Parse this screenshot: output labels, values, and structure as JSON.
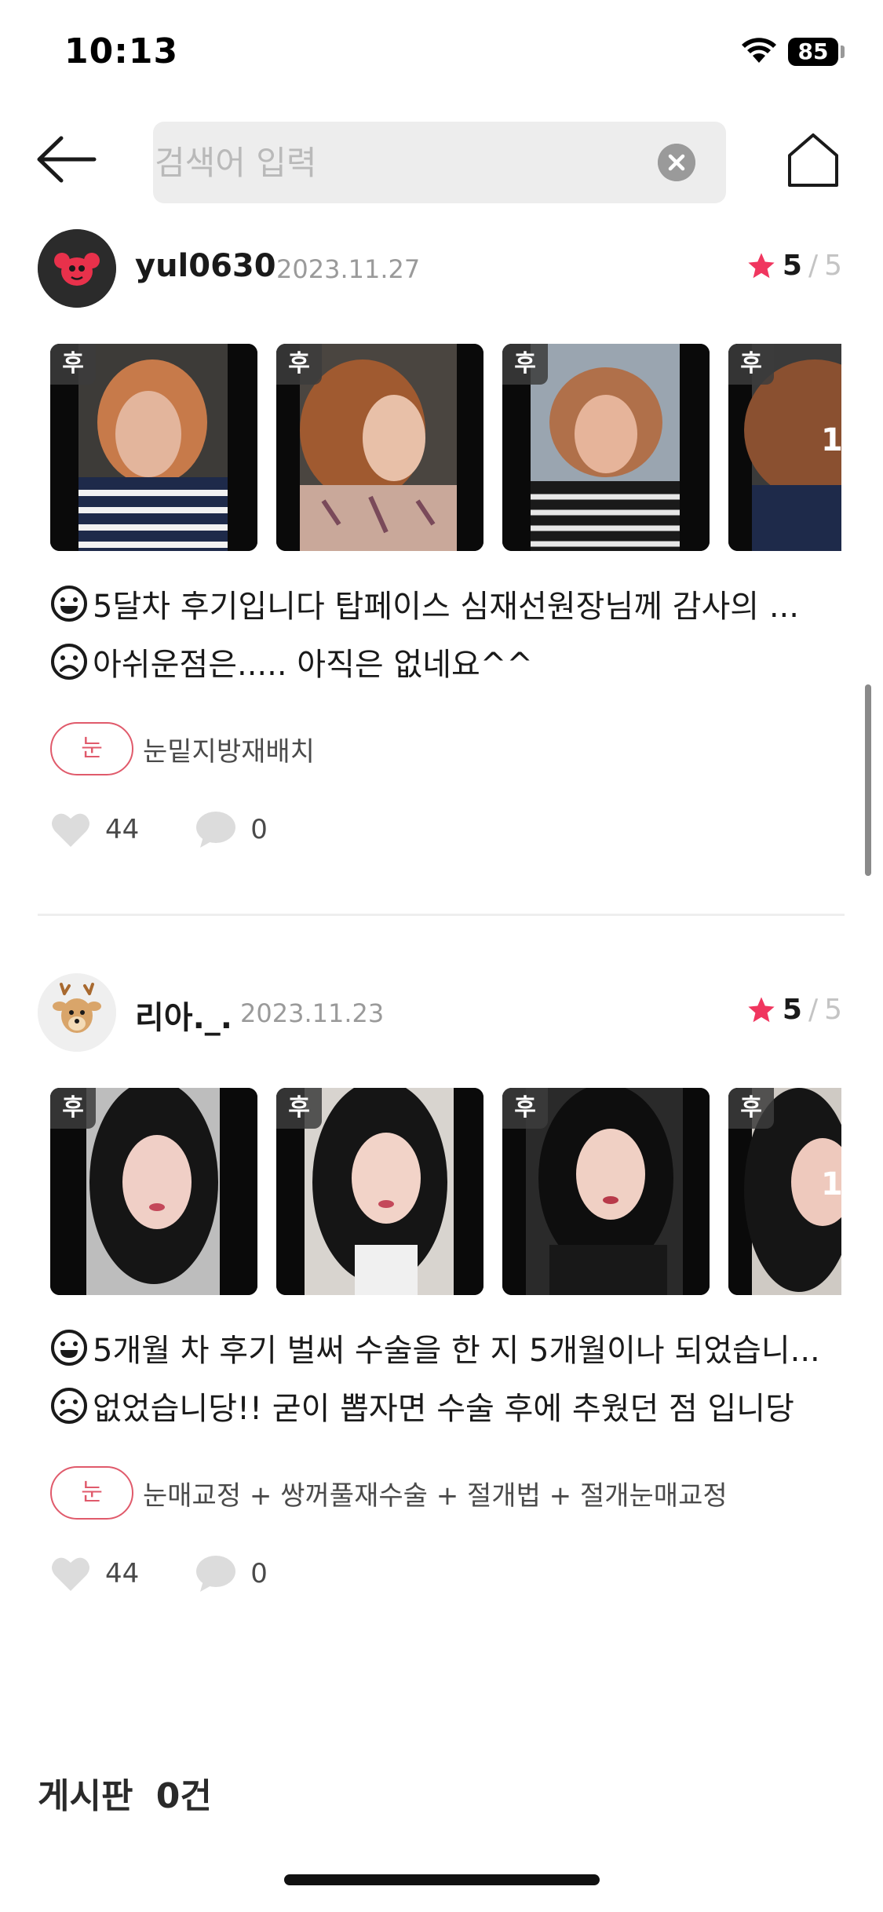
{
  "status_bar": {
    "time": "10:13",
    "battery": "85"
  },
  "search": {
    "placeholder": "검색어 입력",
    "value": ""
  },
  "reviews": [
    {
      "username": "yul0630",
      "date": "2023.11.27",
      "rating": "5",
      "rating_max": "5",
      "photo_badge": "후",
      "photo_count_partial": "1",
      "positive_text": "5달차 후기입니다 탑페이스 심재선원장님께 감사의 ...",
      "negative_text": "아쉬운점은..... 아직은 없네요^^",
      "tag_category": "눈",
      "tag_procedures": "눈밑지방재배치",
      "likes": "44",
      "comments": "0"
    },
    {
      "username": "리아._.",
      "date": "2023.11.23",
      "rating": "5",
      "rating_max": "5",
      "photo_badge": "후",
      "photo_count_partial": "1",
      "positive_text": "5개월 차 후기 벌써 수술을 한 지 5개월이나 되었습니...",
      "negative_text": "없었습니당!! 굳이 뽑자면 수술 후에 추웠던 점 입니당",
      "tag_category": "눈",
      "tag_procedures": "눈매교정 + 쌍꺼풀재수술 + 절개법 + 절개눈매교정",
      "likes": "44",
      "comments": "0"
    }
  ],
  "board": {
    "label": "게시판",
    "count": "0건"
  },
  "colors": {
    "accent": "#e05a6b",
    "star": "#f0365f",
    "muted": "#9a9a9a",
    "search_bg": "#ededed"
  }
}
